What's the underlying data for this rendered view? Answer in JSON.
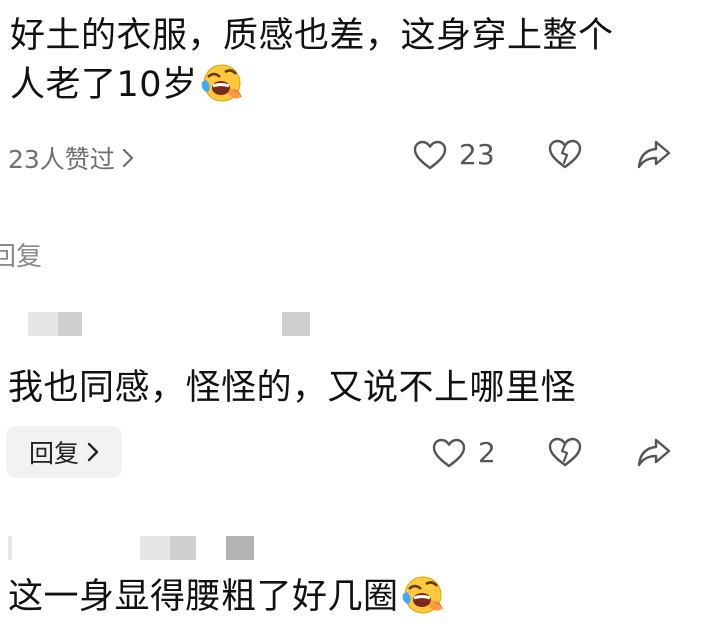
{
  "comments": [
    {
      "text_line1": "好土的衣服，质感也差，这身穿上整个",
      "text_line2": "人老了10岁",
      "emoji": "laughing-crying-emoji",
      "likes_summary": "23人赞过",
      "like_count": "23"
    },
    {
      "text": "我也同感，怪怪的，又说不上哪里怪",
      "reply_label": "回复",
      "like_count": "2"
    },
    {
      "text": "这一身显得腰粗了好几圈",
      "emoji": "laughing-crying-emoji"
    }
  ],
  "reply_link": "回复",
  "icons": {
    "like": "heart-icon",
    "dislike": "broken-heart-icon",
    "share": "share-arrow-icon",
    "more": "chevron-right-icon"
  },
  "colors": {
    "text": "#111111",
    "secondary": "#6f6f6f",
    "icon": "#555555",
    "chip_bg": "#f2f2f2"
  }
}
